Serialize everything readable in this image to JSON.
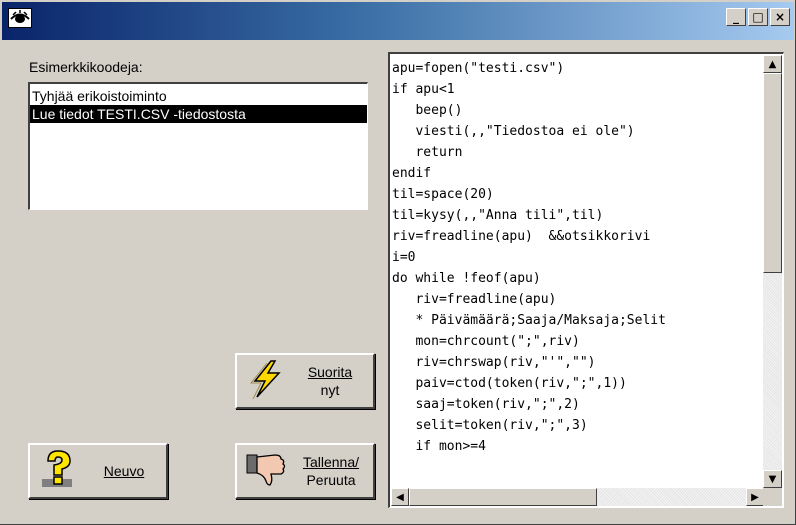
{
  "titlebar": {
    "app_icon": "eye-icon",
    "buttons": {
      "minimize": "_",
      "maximize": "□",
      "close": "×"
    }
  },
  "examples": {
    "label": "Esimerkkikoodeja:",
    "items": [
      {
        "label": "Tyhjää erikoistoiminto",
        "selected": false
      },
      {
        "label": "Lue tiedot TESTI.CSV -tiedostosta",
        "selected": true
      }
    ]
  },
  "buttons": {
    "run": {
      "line1": "Suorita",
      "line2": "nyt",
      "icon": "lightning-icon"
    },
    "help": {
      "label": "Neuvo",
      "icon": "question-icon"
    },
    "save": {
      "line1": "Tallenna/",
      "line2": "Peruuta",
      "icon": "thumbs-down-icon"
    }
  },
  "editor": {
    "lines": [
      "apu=fopen(\"testi.csv\")",
      "if apu<1",
      "   beep()",
      "   viesti(,,\"Tiedostoa ei ole\")",
      "   return",
      "endif",
      "til=space(20)",
      "til=kysy(,,\"Anna tili\",til)",
      "riv=freadline(apu)  &&otsikkorivi",
      "i=0",
      "do while !feof(apu)",
      "   riv=freadline(apu)",
      "   * Päivämäärä;Saaja/Maksaja;Selit",
      "   mon=chrcount(\";\",riv)",
      "   riv=chrswap(riv,\"'\",\"\")",
      "   paiv=ctod(token(riv,\";\",1))",
      "   saaj=token(riv,\";\",2)",
      "   selit=token(riv,\";\",3)",
      "   if mon>=4"
    ],
    "scroll_arrows": {
      "up": "▲",
      "down": "▼",
      "left": "◀",
      "right": "▶"
    }
  },
  "colors": {
    "title_gradient_start": "#0a246a",
    "title_gradient_end": "#a6caf0",
    "face": "#d4d0c8",
    "selection": "#000000"
  }
}
